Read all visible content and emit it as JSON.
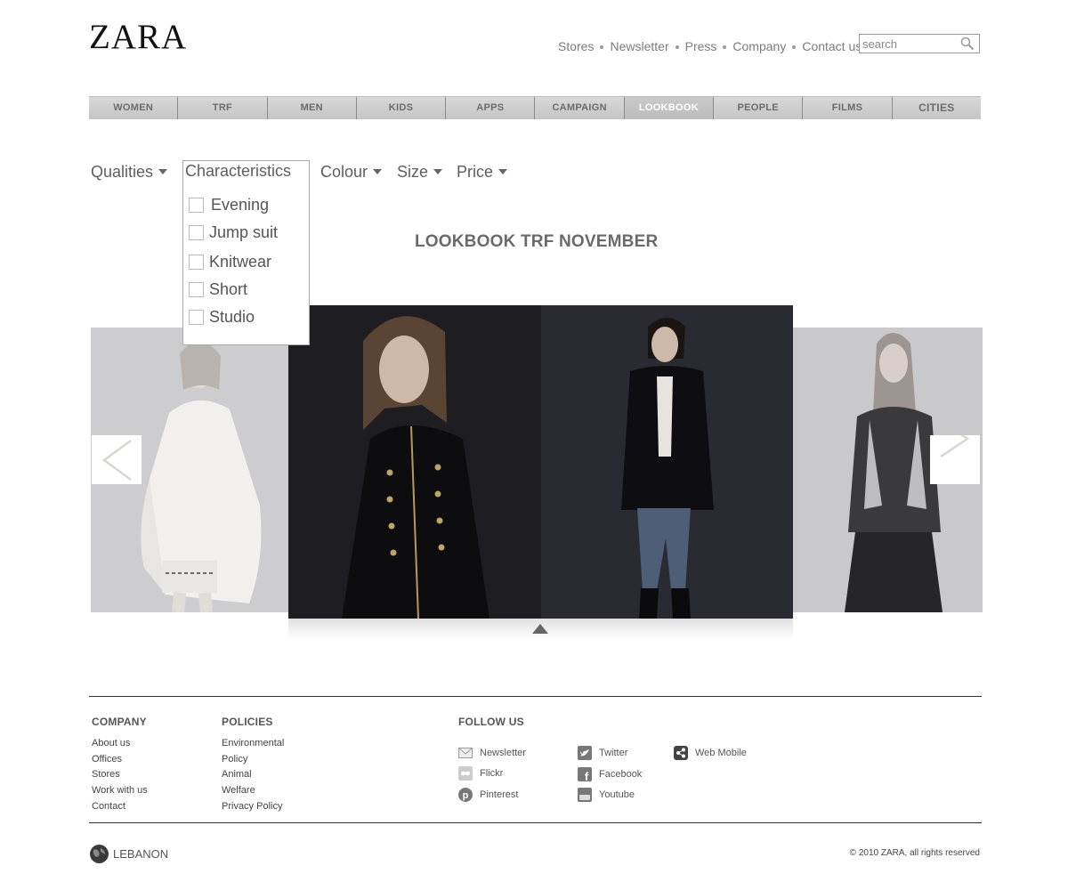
{
  "header": {
    "logo": "ZARA",
    "links": [
      "Stores",
      "Newsletter",
      "Press",
      "Company",
      "Contact us"
    ],
    "search_placeholder": "search"
  },
  "nav": {
    "items": [
      "WOMEN",
      "TRF",
      "MEN",
      "KIDS",
      "APPS",
      "CAMPAIGN",
      "LOOKBOOK",
      "PEOPLE",
      "FILMS",
      "CITIES"
    ],
    "active": "LOOKBOOK"
  },
  "filters": {
    "qualities": "Qualities",
    "characteristics": "Characteristics",
    "colour": "Colour",
    "size": "Size",
    "price": "Price",
    "characteristics_options": [
      "Evening",
      "Jump suit",
      "Knitwear",
      "Short",
      "Studio"
    ]
  },
  "lookbook": {
    "title": "LOOKBOOK TRF NOVEMBER"
  },
  "footer": {
    "company": {
      "heading": "COMPANY",
      "links": [
        "About us",
        "Offices",
        "Stores",
        "Work with us",
        "Contact"
      ]
    },
    "policies": {
      "heading": "POLICIES",
      "links": [
        "Environmental",
        "Policy",
        "Animal",
        "Welfare",
        "Privacy Policy"
      ]
    },
    "follow": {
      "heading": "FOLLOW US",
      "items": [
        "Newsletter",
        "Flickr",
        "Pinterest",
        "Twitter",
        "Facebook",
        "Youtube",
        "Web Mobile"
      ]
    },
    "country": "LEBANON",
    "copyright": "© 2010 ZARA, all rights reserved"
  },
  "colors": {
    "nav_bg": "#c9c9c9",
    "text": "#555555",
    "photo_bg": "#1c1c22"
  }
}
